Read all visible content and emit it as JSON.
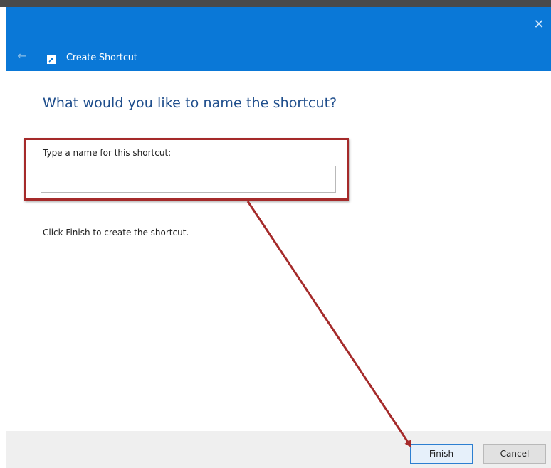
{
  "window": {
    "title": "Create Shortcut",
    "close_glyph": "✕",
    "back_glyph": "←",
    "titlebar_color": "#0a78d7"
  },
  "main": {
    "heading": "What would you like to name the shortcut?",
    "field_label": "Type a name for this shortcut:",
    "field_value": "",
    "info_text": "Click Finish to create the shortcut."
  },
  "buttons": {
    "finish": "Finish",
    "cancel": "Cancel"
  },
  "annotation": {
    "color": "#a52a2a",
    "type": "highlight-box-with-arrow-to-finish"
  },
  "icons": {
    "close": "close-icon",
    "back": "back-arrow-icon",
    "app": "shortcut-icon"
  }
}
